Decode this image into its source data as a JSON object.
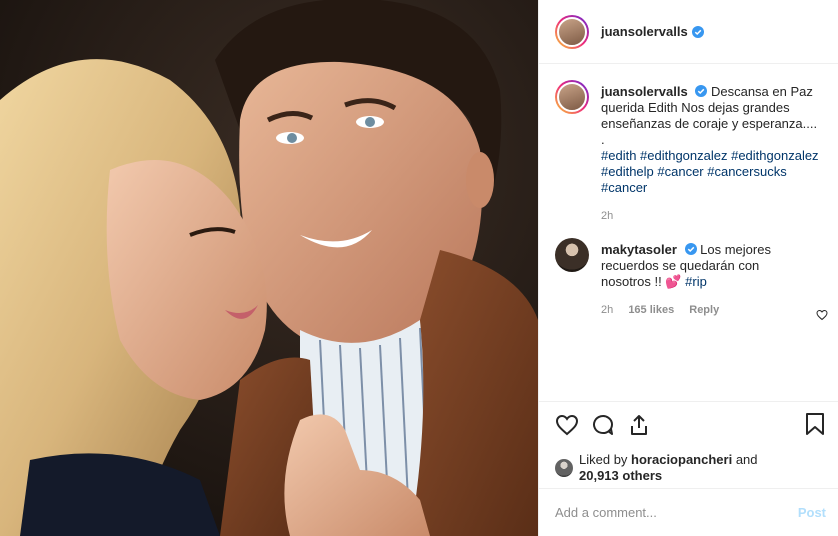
{
  "header": {
    "username": "juansolervalls"
  },
  "caption": {
    "username": "juansolervalls",
    "text": "Descansa en Paz querida Edith Nos dejas grandes enseñanzas de coraje y esperanza....",
    "dot": ".",
    "hashtags": "#edith #edithgonzalez #edithgonzalez #edithelp #cancer #cancersucks #cancer",
    "time": "2h"
  },
  "reply": {
    "username": "makytasoler",
    "text": "Los mejores recuerdos se quedarán con nosotros !!",
    "emoji": "💕",
    "hashtag": "#rip",
    "time": "2h",
    "likes": "165 likes",
    "reply_label": "Reply"
  },
  "likes": {
    "prefix": "Liked by",
    "user": "horaciopancheri",
    "and": "and",
    "count": "20,913 others"
  },
  "add_comment": {
    "placeholder": "Add a comment...",
    "post_label": "Post"
  },
  "colors": {
    "verified": "#3897f0",
    "hashtag": "#003569",
    "post_disabled": "#b2dffc",
    "icon": "#262626"
  },
  "icons": [
    "heart-icon",
    "comment-icon",
    "share-icon",
    "bookmark-icon",
    "verified-icon"
  ]
}
